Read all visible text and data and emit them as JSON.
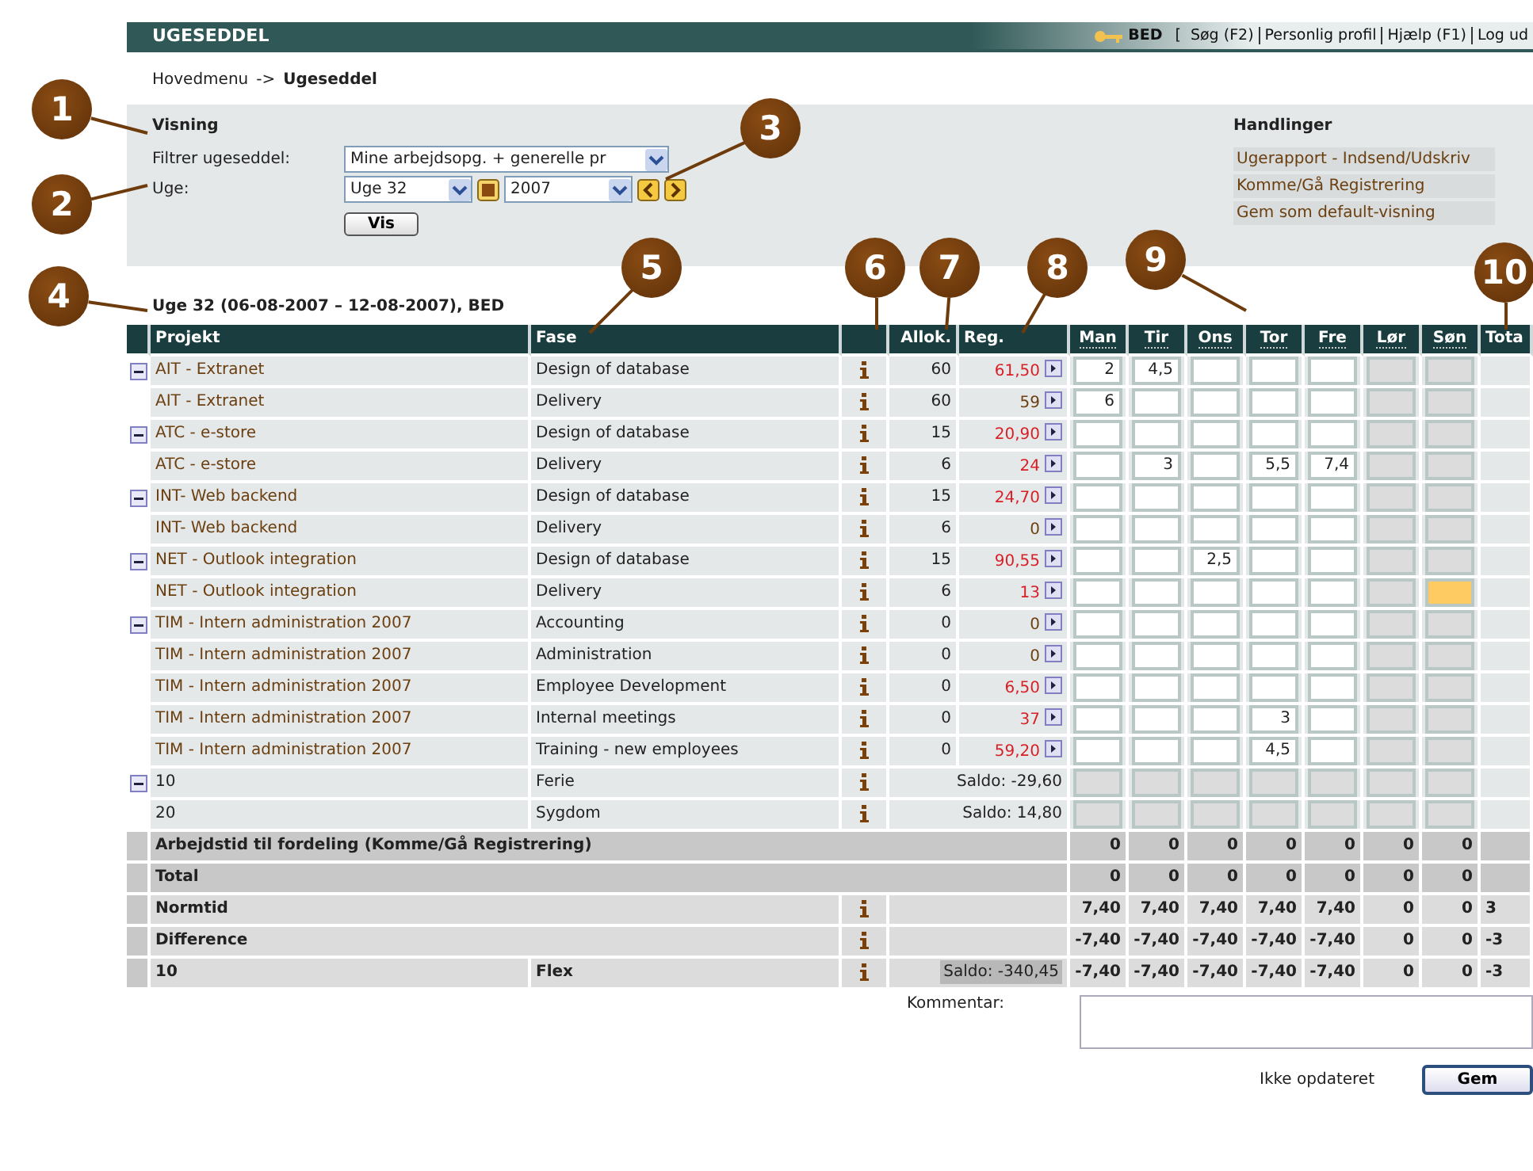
{
  "topbar": {
    "title": "UGESEDDEL",
    "user": "BED",
    "open_bracket": "[",
    "links": [
      "Søg (F2)",
      "Personlig profil",
      "Hjælp (F1)",
      "Log ud"
    ]
  },
  "breadcrumb": {
    "parent": "Hovedmenu",
    "separator": "->",
    "current": "Ugeseddel"
  },
  "view": {
    "heading": "Visning",
    "filter_label": "Filtrer ugeseddel:",
    "filter_value": "Mine arbejdsopg. + generelle pr",
    "week_label": "Uge:",
    "week_value": "Uge 32",
    "year_value": "2007",
    "show_button": "Vis"
  },
  "actions": {
    "heading": "Handlinger",
    "links": [
      "Ugerapport - Indsend/Udskriv",
      "Komme/Gå Registrering",
      "Gem som default-visning"
    ]
  },
  "week_title": "Uge 32 (06-08-2007 – 12-08-2007), BED",
  "table": {
    "columns": {
      "project": "Projekt",
      "phase": "Fase",
      "allocated": "Allok.",
      "registered": "Reg.",
      "days": [
        "Man",
        "Tir",
        "Ons",
        "Tor",
        "Fre",
        "Lør",
        "Søn"
      ],
      "total": "Tota"
    },
    "rows": [
      {
        "kind": "project",
        "collapsible": true,
        "project": "AIT - Extranet",
        "phase": "Design of database",
        "allocated": "60",
        "registered": "61,50",
        "over": true,
        "cells": [
          {
            "value": "2",
            "locked": false,
            "focused": false
          },
          {
            "value": "4,5",
            "locked": false,
            "focused": false
          },
          {
            "locked": false,
            "focused": false
          },
          {
            "locked": false,
            "focused": false
          },
          {
            "locked": false,
            "focused": false
          },
          {
            "locked": true,
            "focused": false
          },
          {
            "locked": true,
            "focused": false
          }
        ]
      },
      {
        "kind": "project",
        "collapsible": false,
        "project": "AIT - Extranet",
        "phase": "Delivery",
        "allocated": "60",
        "registered": "59",
        "over": false,
        "cells": [
          {
            "value": "6",
            "locked": false,
            "focused": false
          },
          {
            "locked": false,
            "focused": false
          },
          {
            "locked": false,
            "focused": false
          },
          {
            "locked": false,
            "focused": false
          },
          {
            "locked": false,
            "focused": false
          },
          {
            "locked": true,
            "focused": false
          },
          {
            "locked": true,
            "focused": false
          }
        ]
      },
      {
        "kind": "project",
        "collapsible": true,
        "project": "ATC - e-store",
        "phase": "Design of database",
        "allocated": "15",
        "registered": "20,90",
        "over": true,
        "cells": [
          {
            "locked": false,
            "focused": false
          },
          {
            "locked": false,
            "focused": false
          },
          {
            "locked": false,
            "focused": false
          },
          {
            "locked": false,
            "focused": false
          },
          {
            "locked": false,
            "focused": false
          },
          {
            "locked": true,
            "focused": false
          },
          {
            "locked": true,
            "focused": false
          }
        ]
      },
      {
        "kind": "project",
        "collapsible": false,
        "project": "ATC - e-store",
        "phase": "Delivery",
        "allocated": "6",
        "registered": "24",
        "over": true,
        "cells": [
          {
            "locked": false,
            "focused": false
          },
          {
            "value": "3",
            "locked": false,
            "focused": false
          },
          {
            "locked": false,
            "focused": false
          },
          {
            "value": "5,5",
            "locked": false,
            "focused": false
          },
          {
            "value": "7,4",
            "locked": false,
            "focused": false
          },
          {
            "locked": true,
            "focused": false
          },
          {
            "locked": true,
            "focused": false
          }
        ]
      },
      {
        "kind": "project",
        "collapsible": true,
        "project": "INT- Web backend",
        "phase": "Design of database",
        "allocated": "15",
        "registered": "24,70",
        "over": true,
        "cells": [
          {
            "locked": false,
            "focused": false
          },
          {
            "locked": false,
            "focused": false
          },
          {
            "locked": false,
            "focused": false
          },
          {
            "locked": false,
            "focused": false
          },
          {
            "locked": false,
            "focused": false
          },
          {
            "locked": true,
            "focused": false
          },
          {
            "locked": true,
            "focused": false
          }
        ]
      },
      {
        "kind": "project",
        "collapsible": false,
        "project": "INT- Web backend",
        "phase": "Delivery",
        "allocated": "6",
        "registered": "0",
        "over": false,
        "cells": [
          {
            "locked": false,
            "focused": false
          },
          {
            "locked": false,
            "focused": false
          },
          {
            "locked": false,
            "focused": false
          },
          {
            "locked": false,
            "focused": false
          },
          {
            "locked": false,
            "focused": false
          },
          {
            "locked": true,
            "focused": false
          },
          {
            "locked": true,
            "focused": false
          }
        ]
      },
      {
        "kind": "project",
        "collapsible": true,
        "project": "NET - Outlook integration",
        "phase": "Design of database",
        "allocated": "15",
        "registered": "90,55",
        "over": true,
        "cells": [
          {
            "locked": false,
            "focused": false
          },
          {
            "locked": false,
            "focused": false
          },
          {
            "value": "2,5",
            "locked": false,
            "focused": false
          },
          {
            "locked": false,
            "focused": false
          },
          {
            "locked": false,
            "focused": false
          },
          {
            "locked": true,
            "focused": false
          },
          {
            "locked": true,
            "focused": false
          }
        ]
      },
      {
        "kind": "project",
        "collapsible": false,
        "project": "NET - Outlook integration",
        "phase": "Delivery",
        "allocated": "6",
        "registered": "13",
        "over": true,
        "cells": [
          {
            "locked": false,
            "focused": false
          },
          {
            "locked": false,
            "focused": false
          },
          {
            "locked": false,
            "focused": false
          },
          {
            "locked": false,
            "focused": false
          },
          {
            "locked": false,
            "focused": false
          },
          {
            "locked": true,
            "focused": false
          },
          {
            "locked": true,
            "focused": true
          }
        ]
      },
      {
        "kind": "project",
        "collapsible": true,
        "project": "TIM - Intern administration 2007",
        "phase": "Accounting",
        "allocated": "0",
        "registered": "0",
        "over": false,
        "cells": [
          {
            "locked": false,
            "focused": false
          },
          {
            "locked": false,
            "focused": false
          },
          {
            "locked": false,
            "focused": false
          },
          {
            "locked": false,
            "focused": false
          },
          {
            "locked": false,
            "focused": false
          },
          {
            "locked": true,
            "focused": false
          },
          {
            "locked": true,
            "focused": false
          }
        ]
      },
      {
        "kind": "project",
        "collapsible": false,
        "project": "TIM - Intern administration 2007",
        "phase": "Administration",
        "allocated": "0",
        "registered": "0",
        "over": false,
        "cells": [
          {
            "locked": false,
            "focused": false
          },
          {
            "locked": false,
            "focused": false
          },
          {
            "locked": false,
            "focused": false
          },
          {
            "locked": false,
            "focused": false
          },
          {
            "locked": false,
            "focused": false
          },
          {
            "locked": true,
            "focused": false
          },
          {
            "locked": true,
            "focused": false
          }
        ]
      },
      {
        "kind": "project",
        "collapsible": false,
        "project": "TIM - Intern administration 2007",
        "phase": "Employee Development",
        "allocated": "0",
        "registered": "6,50",
        "over": true,
        "cells": [
          {
            "locked": false,
            "focused": false
          },
          {
            "locked": false,
            "focused": false
          },
          {
            "locked": false,
            "focused": false
          },
          {
            "locked": false,
            "focused": false
          },
          {
            "locked": false,
            "focused": false
          },
          {
            "locked": true,
            "focused": false
          },
          {
            "locked": true,
            "focused": false
          }
        ]
      },
      {
        "kind": "project",
        "collapsible": false,
        "project": "TIM - Intern administration 2007",
        "phase": "Internal meetings",
        "allocated": "0",
        "registered": "37",
        "over": true,
        "cells": [
          {
            "locked": false,
            "focused": false
          },
          {
            "locked": false,
            "focused": false
          },
          {
            "locked": false,
            "focused": false
          },
          {
            "value": "3",
            "locked": false,
            "focused": false
          },
          {
            "locked": false,
            "focused": false
          },
          {
            "locked": true,
            "focused": false
          },
          {
            "locked": true,
            "focused": false
          }
        ]
      },
      {
        "kind": "project",
        "collapsible": false,
        "project": "TIM - Intern administration 2007",
        "phase": "Training - new employees",
        "allocated": "0",
        "registered": "59,20",
        "over": true,
        "cells": [
          {
            "locked": false,
            "focused": false
          },
          {
            "locked": false,
            "focused": false
          },
          {
            "locked": false,
            "focused": false
          },
          {
            "value": "4,5",
            "locked": false,
            "focused": false
          },
          {
            "locked": false,
            "focused": false
          },
          {
            "locked": true,
            "focused": false
          },
          {
            "locked": true,
            "focused": false
          }
        ]
      },
      {
        "kind": "absence",
        "collapsible": true,
        "project": "10",
        "phase": "Ferie",
        "saldo": "Saldo: -29,60",
        "cells": [
          {
            "locked": true,
            "focused": false
          },
          {
            "locked": true,
            "focused": false
          },
          {
            "locked": true,
            "focused": false
          },
          {
            "locked": true,
            "focused": false
          },
          {
            "locked": true,
            "focused": false
          },
          {
            "locked": true,
            "focused": false
          },
          {
            "locked": true,
            "focused": false
          }
        ]
      },
      {
        "kind": "absence",
        "collapsible": false,
        "project": "20",
        "phase": "Sygdom",
        "saldo": "Saldo: 14,80",
        "cells": [
          {
            "locked": true,
            "focused": false
          },
          {
            "locked": true,
            "focused": false
          },
          {
            "locked": true,
            "focused": false
          },
          {
            "locked": true,
            "focused": false
          },
          {
            "locked": true,
            "focused": false
          },
          {
            "locked": true,
            "focused": false
          },
          {
            "locked": true,
            "focused": false
          }
        ]
      }
    ],
    "summary": [
      {
        "kind": "total",
        "label": "Arbejdstid til fordeling (Komme/Gå Registrering)",
        "values": [
          "0",
          "0",
          "0",
          "0",
          "0",
          "0",
          "0"
        ]
      },
      {
        "kind": "total",
        "label": "Total",
        "values": [
          "0",
          "0",
          "0",
          "0",
          "0",
          "0",
          "0"
        ]
      },
      {
        "kind": "detail",
        "label": "Normtid",
        "values": [
          "7,40",
          "7,40",
          "7,40",
          "7,40",
          "7,40",
          "0",
          "0"
        ],
        "total": "3"
      },
      {
        "kind": "detail",
        "label": "Difference",
        "values": [
          "-7,40",
          "-7,40",
          "-7,40",
          "-7,40",
          "-7,40",
          "0",
          "0"
        ],
        "total": "-3"
      },
      {
        "kind": "detail",
        "label": "10",
        "phase": "Flex",
        "saldo": "Saldo: -340,45",
        "values": [
          "-7,40",
          "-7,40",
          "-7,40",
          "-7,40",
          "-7,40",
          "0",
          "0"
        ],
        "total": "-3"
      }
    ]
  },
  "comment": {
    "label": "Kommentar:"
  },
  "footer": {
    "status": "Ikke opdateret",
    "save_button": "Gem"
  },
  "callouts": [
    "1",
    "2",
    "3",
    "4",
    "5",
    "6",
    "7",
    "8",
    "9",
    "10"
  ]
}
